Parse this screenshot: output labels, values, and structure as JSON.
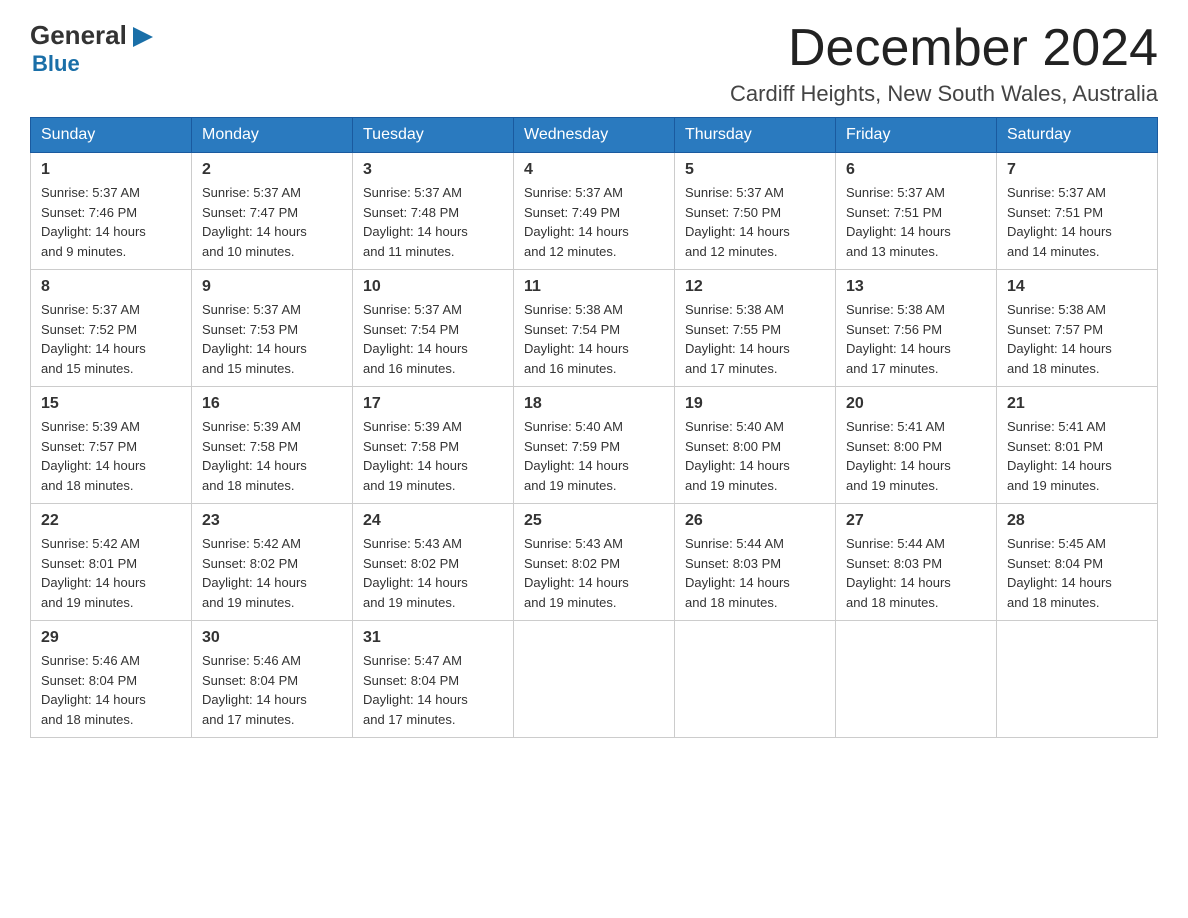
{
  "logo": {
    "general": "General",
    "blue": "Blue",
    "arrow": "▶"
  },
  "header": {
    "month_year": "December 2024",
    "location": "Cardiff Heights, New South Wales, Australia"
  },
  "weekdays": [
    "Sunday",
    "Monday",
    "Tuesday",
    "Wednesday",
    "Thursday",
    "Friday",
    "Saturday"
  ],
  "weeks": [
    [
      {
        "day": "1",
        "sunrise": "5:37 AM",
        "sunset": "7:46 PM",
        "daylight": "14 hours and 9 minutes."
      },
      {
        "day": "2",
        "sunrise": "5:37 AM",
        "sunset": "7:47 PM",
        "daylight": "14 hours and 10 minutes."
      },
      {
        "day": "3",
        "sunrise": "5:37 AM",
        "sunset": "7:48 PM",
        "daylight": "14 hours and 11 minutes."
      },
      {
        "day": "4",
        "sunrise": "5:37 AM",
        "sunset": "7:49 PM",
        "daylight": "14 hours and 12 minutes."
      },
      {
        "day": "5",
        "sunrise": "5:37 AM",
        "sunset": "7:50 PM",
        "daylight": "14 hours and 12 minutes."
      },
      {
        "day": "6",
        "sunrise": "5:37 AM",
        "sunset": "7:51 PM",
        "daylight": "14 hours and 13 minutes."
      },
      {
        "day": "7",
        "sunrise": "5:37 AM",
        "sunset": "7:51 PM",
        "daylight": "14 hours and 14 minutes."
      }
    ],
    [
      {
        "day": "8",
        "sunrise": "5:37 AM",
        "sunset": "7:52 PM",
        "daylight": "14 hours and 15 minutes."
      },
      {
        "day": "9",
        "sunrise": "5:37 AM",
        "sunset": "7:53 PM",
        "daylight": "14 hours and 15 minutes."
      },
      {
        "day": "10",
        "sunrise": "5:37 AM",
        "sunset": "7:54 PM",
        "daylight": "14 hours and 16 minutes."
      },
      {
        "day": "11",
        "sunrise": "5:38 AM",
        "sunset": "7:54 PM",
        "daylight": "14 hours and 16 minutes."
      },
      {
        "day": "12",
        "sunrise": "5:38 AM",
        "sunset": "7:55 PM",
        "daylight": "14 hours and 17 minutes."
      },
      {
        "day": "13",
        "sunrise": "5:38 AM",
        "sunset": "7:56 PM",
        "daylight": "14 hours and 17 minutes."
      },
      {
        "day": "14",
        "sunrise": "5:38 AM",
        "sunset": "7:57 PM",
        "daylight": "14 hours and 18 minutes."
      }
    ],
    [
      {
        "day": "15",
        "sunrise": "5:39 AM",
        "sunset": "7:57 PM",
        "daylight": "14 hours and 18 minutes."
      },
      {
        "day": "16",
        "sunrise": "5:39 AM",
        "sunset": "7:58 PM",
        "daylight": "14 hours and 18 minutes."
      },
      {
        "day": "17",
        "sunrise": "5:39 AM",
        "sunset": "7:58 PM",
        "daylight": "14 hours and 19 minutes."
      },
      {
        "day": "18",
        "sunrise": "5:40 AM",
        "sunset": "7:59 PM",
        "daylight": "14 hours and 19 minutes."
      },
      {
        "day": "19",
        "sunrise": "5:40 AM",
        "sunset": "8:00 PM",
        "daylight": "14 hours and 19 minutes."
      },
      {
        "day": "20",
        "sunrise": "5:41 AM",
        "sunset": "8:00 PM",
        "daylight": "14 hours and 19 minutes."
      },
      {
        "day": "21",
        "sunrise": "5:41 AM",
        "sunset": "8:01 PM",
        "daylight": "14 hours and 19 minutes."
      }
    ],
    [
      {
        "day": "22",
        "sunrise": "5:42 AM",
        "sunset": "8:01 PM",
        "daylight": "14 hours and 19 minutes."
      },
      {
        "day": "23",
        "sunrise": "5:42 AM",
        "sunset": "8:02 PM",
        "daylight": "14 hours and 19 minutes."
      },
      {
        "day": "24",
        "sunrise": "5:43 AM",
        "sunset": "8:02 PM",
        "daylight": "14 hours and 19 minutes."
      },
      {
        "day": "25",
        "sunrise": "5:43 AM",
        "sunset": "8:02 PM",
        "daylight": "14 hours and 19 minutes."
      },
      {
        "day": "26",
        "sunrise": "5:44 AM",
        "sunset": "8:03 PM",
        "daylight": "14 hours and 18 minutes."
      },
      {
        "day": "27",
        "sunrise": "5:44 AM",
        "sunset": "8:03 PM",
        "daylight": "14 hours and 18 minutes."
      },
      {
        "day": "28",
        "sunrise": "5:45 AM",
        "sunset": "8:04 PM",
        "daylight": "14 hours and 18 minutes."
      }
    ],
    [
      {
        "day": "29",
        "sunrise": "5:46 AM",
        "sunset": "8:04 PM",
        "daylight": "14 hours and 18 minutes."
      },
      {
        "day": "30",
        "sunrise": "5:46 AM",
        "sunset": "8:04 PM",
        "daylight": "14 hours and 17 minutes."
      },
      {
        "day": "31",
        "sunrise": "5:47 AM",
        "sunset": "8:04 PM",
        "daylight": "14 hours and 17 minutes."
      },
      null,
      null,
      null,
      null
    ]
  ],
  "labels": {
    "sunrise": "Sunrise:",
    "sunset": "Sunset:",
    "daylight": "Daylight:"
  }
}
